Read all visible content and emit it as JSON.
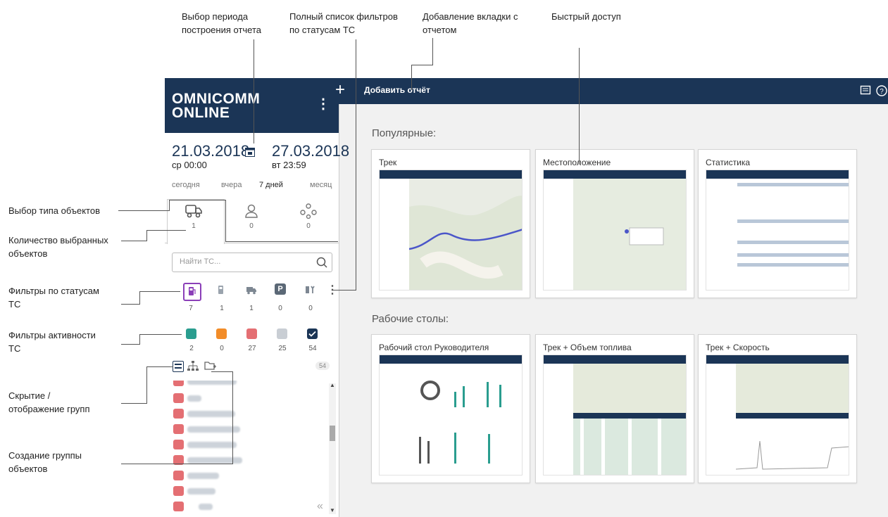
{
  "callouts": {
    "period": [
      "Выбор периода",
      "построения отчета"
    ],
    "filters_full": [
      "Полный список фильтров",
      "по статусам ТС"
    ],
    "add_tab": [
      "Добавление вкладки с",
      "отчетом"
    ],
    "quick_access": "Быстрый доступ",
    "object_type": "Выбор типа объектов",
    "object_count": [
      "Количество выбранных",
      "объектов"
    ],
    "status_filters": [
      "Фильтры по статусам",
      "ТС"
    ],
    "activity_filters": [
      "Фильтры активности",
      "ТС"
    ],
    "groups_toggle": [
      "Скрытие /",
      "отображение групп"
    ],
    "group_create": [
      "Создание группы",
      "объектов"
    ]
  },
  "sidebar": {
    "logo_line1": "OMNICOMM",
    "logo_line2": "ONLINE",
    "date_from": "21.03.2018",
    "time_from": "ср 00:00",
    "date_to": "27.03.2018",
    "time_to": "вт 23:59",
    "periods": [
      "сегодня",
      "вчера",
      "7 дней",
      "месяц"
    ],
    "object_tabs": [
      {
        "icon": "truck-icon",
        "count": "1"
      },
      {
        "icon": "person-icon",
        "count": "0"
      },
      {
        "icon": "group-icon",
        "count": "0"
      }
    ],
    "search_placeholder": "Найти ТС...",
    "status_filters": [
      {
        "icon": "fuel-station-icon",
        "count": "7"
      },
      {
        "icon": "fuel-icon",
        "count": "1"
      },
      {
        "icon": "truck-moving-icon",
        "count": "1"
      },
      {
        "icon": "parking-icon",
        "count": "0"
      },
      {
        "icon": "service-icon",
        "count": "0"
      }
    ],
    "activity_filters": [
      {
        "color": "#2a9d8f",
        "count": "2"
      },
      {
        "color": "#f28c28",
        "count": "0"
      },
      {
        "color": "#e46f73",
        "count": "27"
      },
      {
        "color": "#c9ced4",
        "count": "25"
      },
      {
        "color": "#1b3556",
        "count": "54"
      }
    ],
    "total_badge": "54"
  },
  "topbar": {
    "add_label": "Добавить отчёт",
    "plus": "+"
  },
  "main": {
    "popular_title": "Популярные:",
    "popular": [
      "Трек",
      "Местоположение",
      "Статистика"
    ],
    "desks_title": "Рабочие столы:",
    "desks": [
      "Рабочий стол Руководителя",
      "Трек + Объем топлива",
      "Трек + Скорость"
    ]
  },
  "colors": {
    "brand": "#1b3556",
    "accent_purple": "#8b3fb8",
    "teal": "#2a9d8f"
  }
}
